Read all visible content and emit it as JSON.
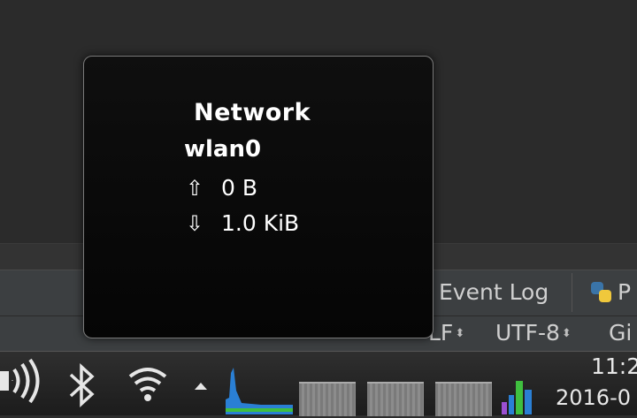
{
  "tooltip": {
    "title": "Network",
    "interface": "wlan0",
    "upload": {
      "icon": "⇧",
      "value": "0 B"
    },
    "download": {
      "icon": "⇩",
      "value": "1.0 KiB"
    }
  },
  "ide": {
    "tool_tabs": {
      "event_log": "Event Log",
      "python": "P"
    },
    "status_bar": {
      "line_sep": "LF",
      "encoding": "UTF-8",
      "vcs": "Gi",
      "dropdown_glyph": "⬍"
    }
  },
  "taskbar": {
    "tray_icons": [
      "volume-icon",
      "bluetooth-icon",
      "wifi-icon",
      "tray-expand-icon"
    ],
    "clock": {
      "time": "11:2",
      "date": "2016-0"
    }
  },
  "colors": {
    "tooltip_bg": "#050505",
    "tooltip_border": "#7a7a7a",
    "graph_blue": "#2a7fd4",
    "graph_green": "#3fbf3f"
  }
}
